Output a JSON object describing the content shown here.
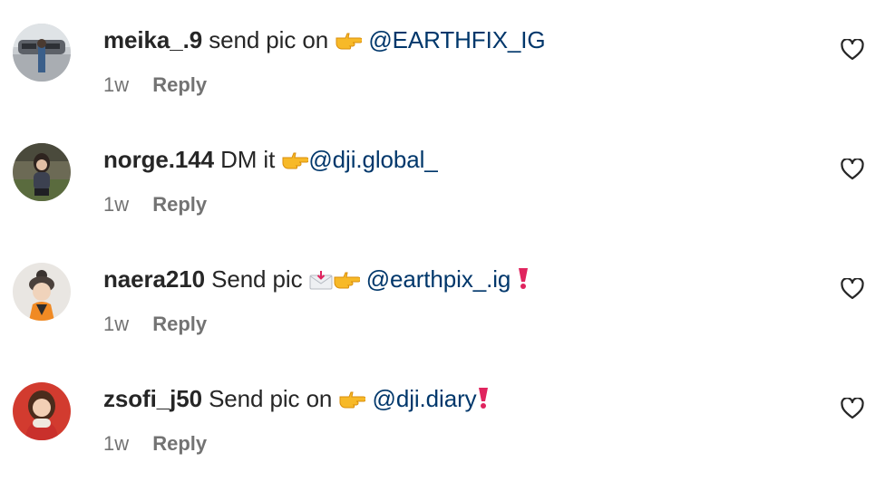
{
  "comments": [
    {
      "username": "meika_.9",
      "text": "send pic on",
      "emojis": "point-right",
      "mention": "@EARTHFIX_IG",
      "trailing": "",
      "time": "1w",
      "reply": "Reply"
    },
    {
      "username": "norge.144",
      "text": "DM it",
      "emojis": "point-right",
      "mention": "@dji.global_",
      "trailing": "",
      "time": "1w",
      "reply": "Reply"
    },
    {
      "username": "naera210",
      "text": "Send pic",
      "emojis": "envelope-arrow, point-right",
      "mention": "@earthpix_.ig",
      "trailing": "red-exclamation",
      "time": "1w",
      "reply": "Reply"
    },
    {
      "username": "zsofi_j50",
      "text": "Send pic on",
      "emojis": "point-right",
      "mention": "@dji.diary",
      "trailing": "red-exclamation",
      "time": "1w",
      "reply": "Reply"
    }
  ],
  "icons": {
    "like": "heart-outline-icon",
    "emoji": "point-right-emoji"
  },
  "colors": {
    "text": "#262626",
    "mention": "#00376b",
    "meta": "#737373",
    "exclamation": "#e0245e"
  }
}
